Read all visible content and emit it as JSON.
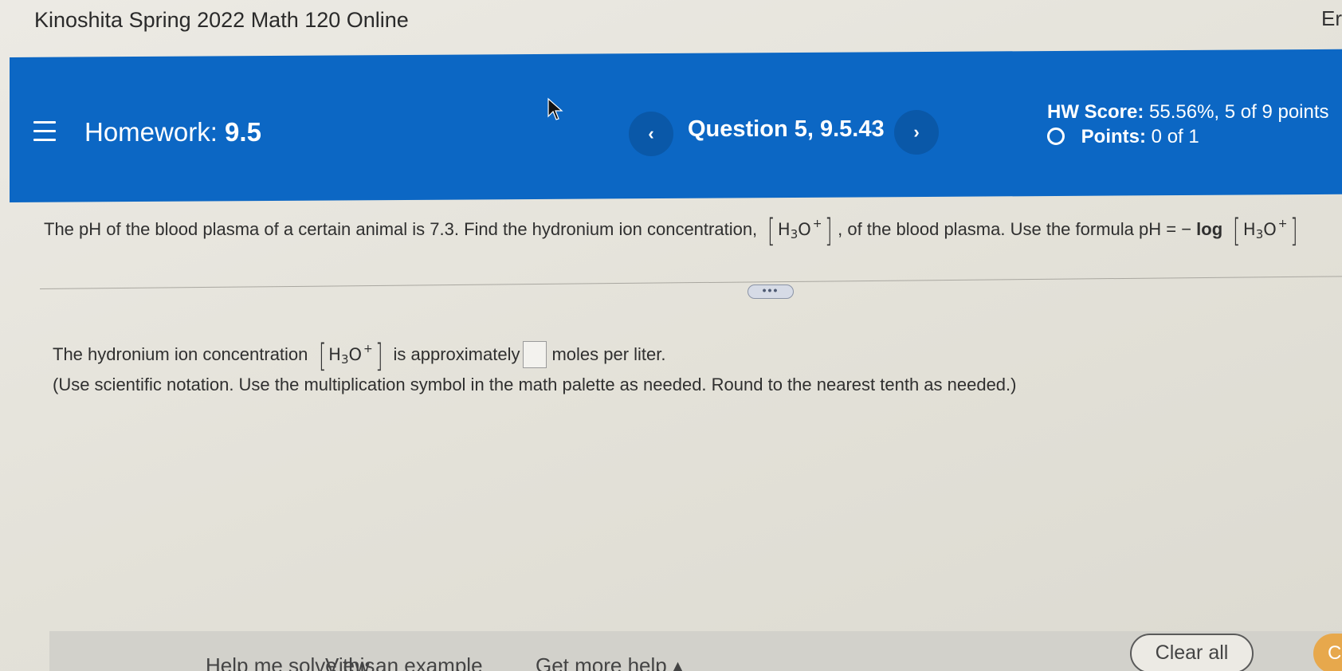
{
  "course": {
    "title": "Kinoshita Spring 2022 Math 120 Online",
    "right_text": "Er"
  },
  "header": {
    "homework_prefix": "Homework:",
    "homework_number": "9.5",
    "prev_label": "‹",
    "next_label": "›",
    "question_label": "Question 5, 9.5.43",
    "hw_score_label": "HW Score:",
    "hw_score_value": "55.56%, 5 of 9 points",
    "points_label": "Points:",
    "points_value": "0 of 1"
  },
  "question": {
    "text_before": "The pH of the blood plasma of a certain animal is 7.3. Find the hydronium ion concentration,",
    "text_middle": ", of the blood plasma. Use the formula pH = −",
    "log_word": "log",
    "chem_H": "H",
    "chem_sub": "3",
    "chem_O": "O",
    "chem_sup": "+"
  },
  "more_button": "•••",
  "answer": {
    "prefix": "The hydronium ion concentration",
    "middle": "is approximately",
    "suffix": "moles per liter.",
    "instruction": "(Use scientific notation. Use the multiplication symbol in the math palette as needed. Round to the nearest tenth as needed.)"
  },
  "bottom": {
    "help_me_solve": "Help me solve this",
    "view_example": "View an example",
    "get_more_help": "Get more help ▴",
    "clear_all": "Clear all",
    "check_answer": "C"
  },
  "colors": {
    "header_blue": "#0c67c4",
    "check_orange": "#e7a84c"
  }
}
